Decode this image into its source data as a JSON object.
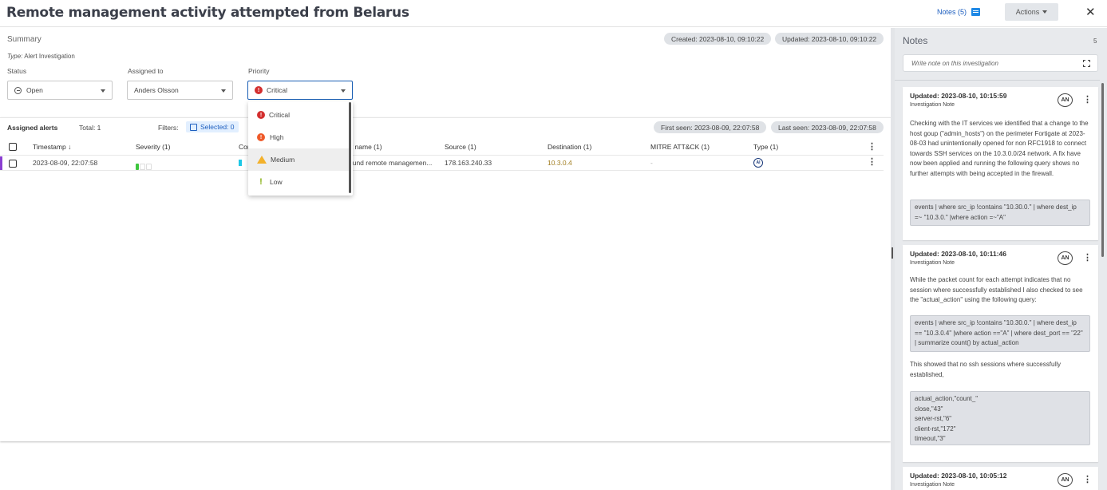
{
  "header": {
    "title": "Remote management activity attempted from Belarus",
    "notes_link": "Notes (5)",
    "actions_label": "Actions",
    "close_symbol": "✕"
  },
  "summary": {
    "label": "Summary",
    "type_prefix": "Type:",
    "type_value": "Alert Investigation",
    "created": "Created: 2023-08-10, 09:10:22",
    "updated": "Updated: 2023-08-10, 09:10:22"
  },
  "fields": {
    "status_label": "Status",
    "status_value": "Open",
    "assigned_label": "Assigned to",
    "assigned_value": "Anders Olsson",
    "priority_label": "Priority",
    "priority_value": "Critical"
  },
  "priority_options": [
    "Critical",
    "High",
    "Medium",
    "Low"
  ],
  "alerts": {
    "title": "Assigned alerts",
    "total": "Total: 1",
    "filters_label": "Filters:",
    "selected_chip": "Selected: 0",
    "first_seen": "First seen: 2023-08-09, 22:07:58",
    "last_seen": "Last seen: 2023-08-09, 22:07:58",
    "columns": {
      "timestamp": "Timestamp ↓",
      "severity": "Severity (1)",
      "confidence": "Con",
      "alert_name": "rt name (1)",
      "source": "Source (1)",
      "destination": "Destination (1)",
      "mitre": "MITRE ATT&CK (1)",
      "type": "Type (1)"
    },
    "row": {
      "timestamp": "2023-08-09, 22:07:58",
      "alert_name": "ound remote managemen...",
      "source": "178.163.240.33",
      "destination": "10.3.0.4",
      "mitre": "-",
      "type_badge": "AI"
    },
    "severity_level": 1,
    "colors": {
      "severity": "#3ec63e",
      "confidence": "#1ec8e6",
      "row_accent": "#8a3fd1",
      "destination_link": "#a07c1e"
    }
  },
  "notes_panel": {
    "title": "Notes",
    "count": "5",
    "input_placeholder": "Write note on this investigation",
    "notes": [
      {
        "updated": "Updated: 2023-08-10, 10:15:59",
        "kind": "Investigation Note",
        "author_initials": "AN",
        "text": "Checking with the IT services we identified that a change to the host goup (\"admin_hosts\") on the perimeter Fortigate at 2023-08-03 had unintentionally opened for non RFC1918 to connect towards SSH services on the 10.3.0.0/24 network. A fix have now been applied and running the following query shows no further attempts with being accepted in the firewall.",
        "code": "events | where src_ip !contains \"10.30.0.\" | where dest_ip =~ \"10.3.0.\" |where action =~\"A\""
      },
      {
        "updated": "Updated: 2023-08-10, 10:11:46",
        "kind": "Investigation Note",
        "author_initials": "AN",
        "text": "While the packet count for each attempt indicates that no session where successfully established I also checked to see the \"actual_action\" using the following query:",
        "code": "events | where src_ip !contains \"10.30.0.\" | where dest_ip == \"10.3.0.4\" |where action ==\"A\" | where dest_port == \"22\" | summarize count() by actual_action",
        "text2": "This showed that no ssh sessions where successfully established,",
        "code2": "actual_action,\"count_\"\nclose,\"43\"\nserver-rst,\"6\"\nclient-rst,\"172\"\ntimeout,\"3\""
      },
      {
        "updated": "Updated: 2023-08-10, 10:05:12",
        "kind": "Investigation Note",
        "author_initials": "AN"
      }
    ]
  },
  "colors": {
    "accent": "#1a5fb4",
    "critical": "#d32f2f",
    "high": "#ef5a2a",
    "medium": "#f3b12b",
    "low": "#8bb31a"
  },
  "icons": {
    "notes": "chat-icon",
    "close": "close-icon",
    "status": "open-circle-icon",
    "critical": "critical-icon",
    "high": "high-icon",
    "medium": "warning-icon",
    "low": "low-icon",
    "expand": "expand-icon"
  }
}
